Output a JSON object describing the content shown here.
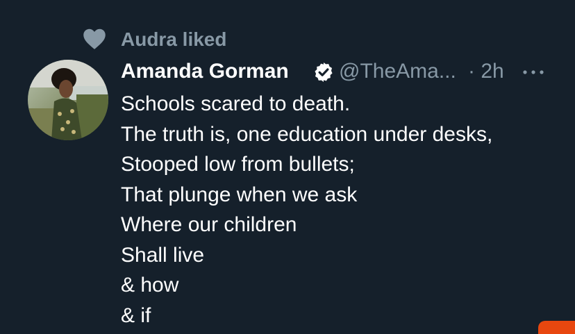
{
  "social_context": {
    "icon": "heart-icon",
    "text": "Audra liked"
  },
  "author": {
    "display_name": "Amanda Gorman",
    "verified": true,
    "verified_icon": "verified-badge-icon",
    "handle": "@TheAma...",
    "time": "· 2h",
    "more_icon": "more-options-icon"
  },
  "tweet": {
    "lines": [
      "Schools scared to death.",
      "The truth is, one education under desks,",
      "Stooped low from bullets;",
      "That plunge when we ask",
      "Where our children",
      "Shall live",
      "& how",
      "& if"
    ]
  },
  "colors": {
    "background": "#15202b",
    "primary_text": "#ffffff",
    "secondary_text": "#8899a6",
    "accent_orange": "#e8470f"
  }
}
